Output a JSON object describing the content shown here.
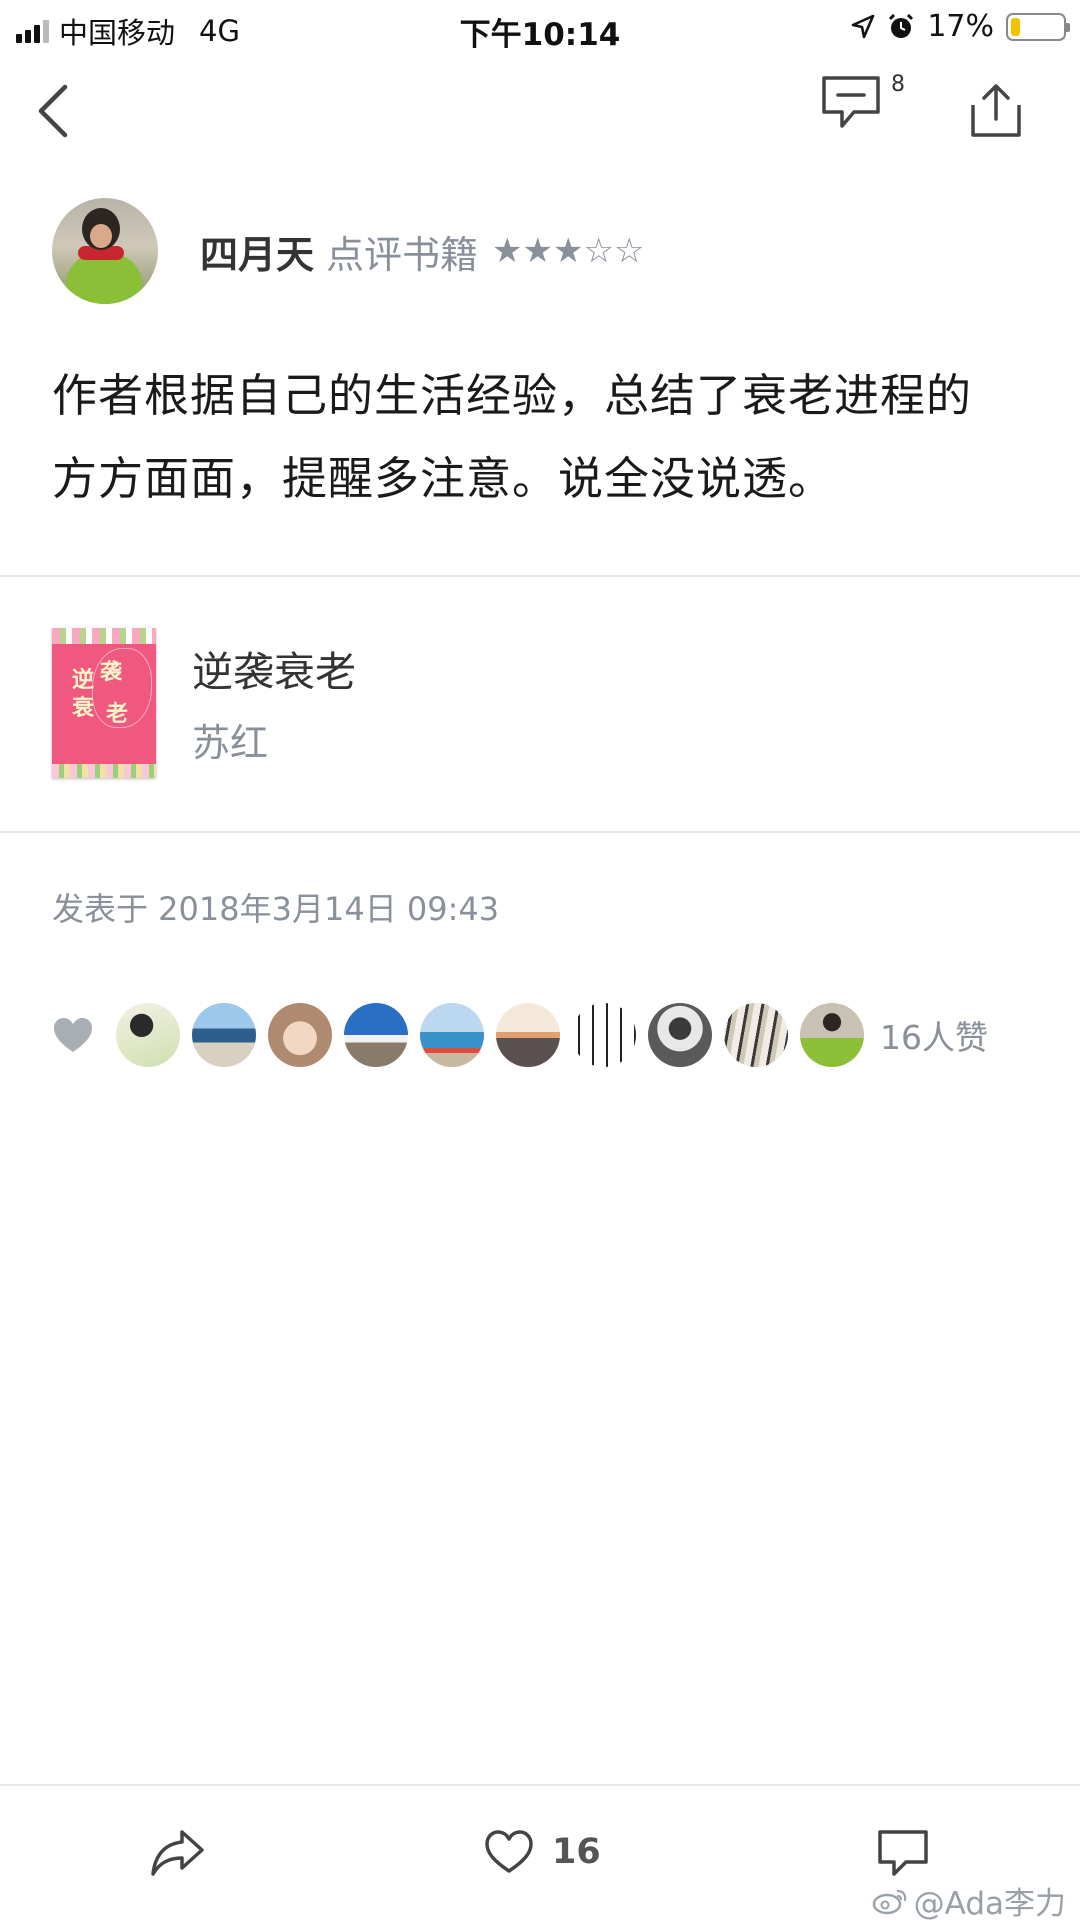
{
  "status_bar": {
    "carrier": "中国移动",
    "network": "4G",
    "time": "下午10:14",
    "battery_text": "17%",
    "battery_level": 0.17,
    "battery_color": "#f2c400",
    "icons": [
      "signal-icon",
      "location-icon",
      "alarm-icon",
      "battery-icon"
    ]
  },
  "nav": {
    "back_icon": "chevron-left-icon",
    "comment_icon": "comment-icon",
    "comment_count": "8",
    "share_icon": "share-icon"
  },
  "review": {
    "reviewer_name": "四月天",
    "action_text": "点评书籍",
    "rating": 3,
    "rating_max": 5,
    "stars_text": "★★★☆☆",
    "text_line1": "作者根据自己的生活经验，总结了衰老进程的",
    "text_line2": "方方面面，提醒多注意。说全没说透。"
  },
  "book": {
    "title": "逆袭衰老",
    "author": "苏红",
    "cover_chars": [
      "逆",
      "袭",
      "衰",
      "老"
    ],
    "cover_color": "#f0587f"
  },
  "post_date": "发表于 2018年3月14日 09:43",
  "likes": {
    "heart_icon": "heart-icon",
    "count_text": "16人赞",
    "liker_count_shown": 10
  },
  "bottom_bar": {
    "forward_icon": "forward-icon",
    "like_icon": "heart-outline-icon",
    "like_count": "16",
    "comment_icon": "comment-bubble-icon"
  },
  "watermark": {
    "text": "@Ada李力",
    "icon": "weibo-icon"
  },
  "colors": {
    "secondary_text": "#8a9099",
    "primary_text": "#1a1a1a",
    "divider": "#e6e6e6"
  }
}
